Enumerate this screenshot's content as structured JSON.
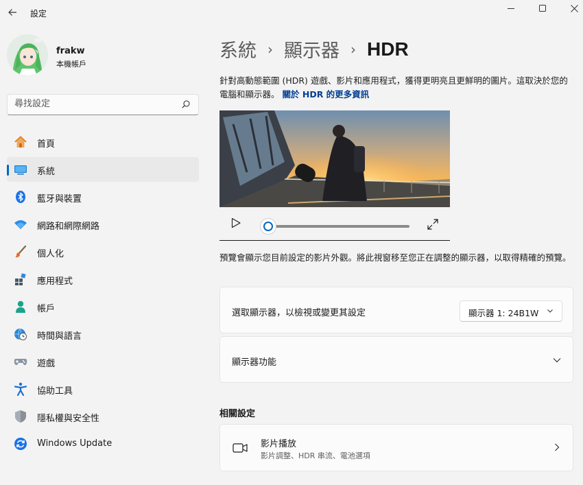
{
  "window": {
    "title": "設定"
  },
  "profile": {
    "name": "frakw",
    "account_type": "本機帳戶"
  },
  "search": {
    "placeholder": "尋找設定"
  },
  "sidebar": {
    "items": [
      {
        "label": "首頁",
        "icon": "home-icon"
      },
      {
        "label": "系統",
        "icon": "system-icon",
        "active": true
      },
      {
        "label": "藍牙與裝置",
        "icon": "bluetooth-icon"
      },
      {
        "label": "網路和網際網路",
        "icon": "wifi-icon"
      },
      {
        "label": "個人化",
        "icon": "brush-icon"
      },
      {
        "label": "應用程式",
        "icon": "apps-icon"
      },
      {
        "label": "帳戶",
        "icon": "account-icon"
      },
      {
        "label": "時間與語言",
        "icon": "globe-clock-icon"
      },
      {
        "label": "遊戲",
        "icon": "gamepad-icon"
      },
      {
        "label": "協助工具",
        "icon": "accessibility-icon"
      },
      {
        "label": "隱私權與安全性",
        "icon": "shield-icon"
      },
      {
        "label": "Windows Update",
        "icon": "update-icon"
      }
    ]
  },
  "breadcrumb": {
    "items": [
      "系統",
      "顯示器"
    ],
    "current": "HDR"
  },
  "description": {
    "text": "針對高動態範圍 (HDR) 遊戲、影片和應用程式，獲得更明亮且更鮮明的圖片。這取決於您的電腦和顯示器。",
    "link": "關於 HDR 的更多資訊"
  },
  "video_player": {
    "progress": 0.0
  },
  "preview_note": "預覽會顯示您目前設定的影片外觀。將此視窗移至您正在調整的顯示器，以取得精確的預覽。",
  "display_select": {
    "label": "選取顯示器，以檢視或變更其設定",
    "value": "顯示器 1: 24B1W"
  },
  "display_features": {
    "label": "顯示器功能"
  },
  "related": {
    "title": "相關設定",
    "items": [
      {
        "title": "影片播放",
        "subtitle": "影片調整、HDR 串流、電池選項"
      }
    ]
  },
  "colors": {
    "accent": "#0067c0",
    "link": "#003e92",
    "background": "#f3f3f3"
  }
}
